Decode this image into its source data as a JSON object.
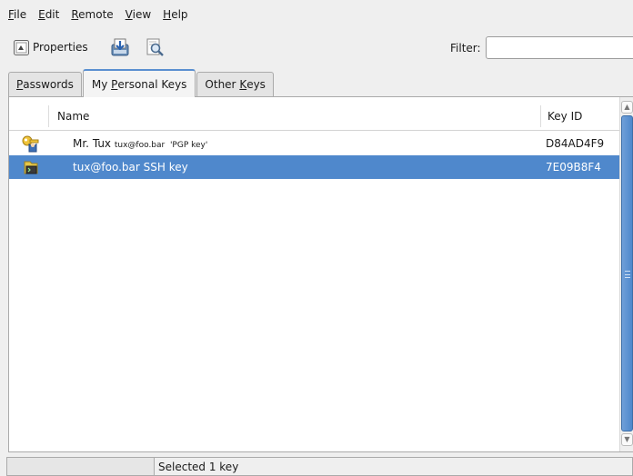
{
  "menubar": {
    "items": [
      {
        "pre": "",
        "u": "F",
        "post": "ile"
      },
      {
        "pre": "",
        "u": "E",
        "post": "dit"
      },
      {
        "pre": "",
        "u": "R",
        "post": "emote"
      },
      {
        "pre": "",
        "u": "V",
        "post": "iew"
      },
      {
        "pre": "",
        "u": "H",
        "post": "elp"
      }
    ]
  },
  "toolbar": {
    "properties_label": "Properties",
    "filter_label": "Filter:",
    "filter_value": ""
  },
  "tabs": [
    {
      "pre": "",
      "u": "P",
      "post": "asswords"
    },
    {
      "pre": "My ",
      "u": "P",
      "post": "ersonal Keys"
    },
    {
      "pre": "Other ",
      "u": "K",
      "post": "eys"
    }
  ],
  "table": {
    "col_name": "Name",
    "col_keyid": "Key ID",
    "rows": [
      {
        "name": "Mr. Tux",
        "detail": "tux@foo.bar  'PGP key'",
        "keyid": "D84AD4F9",
        "icon": "pgp-key-icon"
      },
      {
        "name": "tux@foo.bar SSH key",
        "detail": "",
        "keyid": "7E09B8F4",
        "icon": "ssh-key-icon"
      }
    ]
  },
  "statusbar": {
    "text": "Selected 1 key"
  },
  "colors": {
    "selection": "#4f88cc",
    "background": "#efefef"
  }
}
